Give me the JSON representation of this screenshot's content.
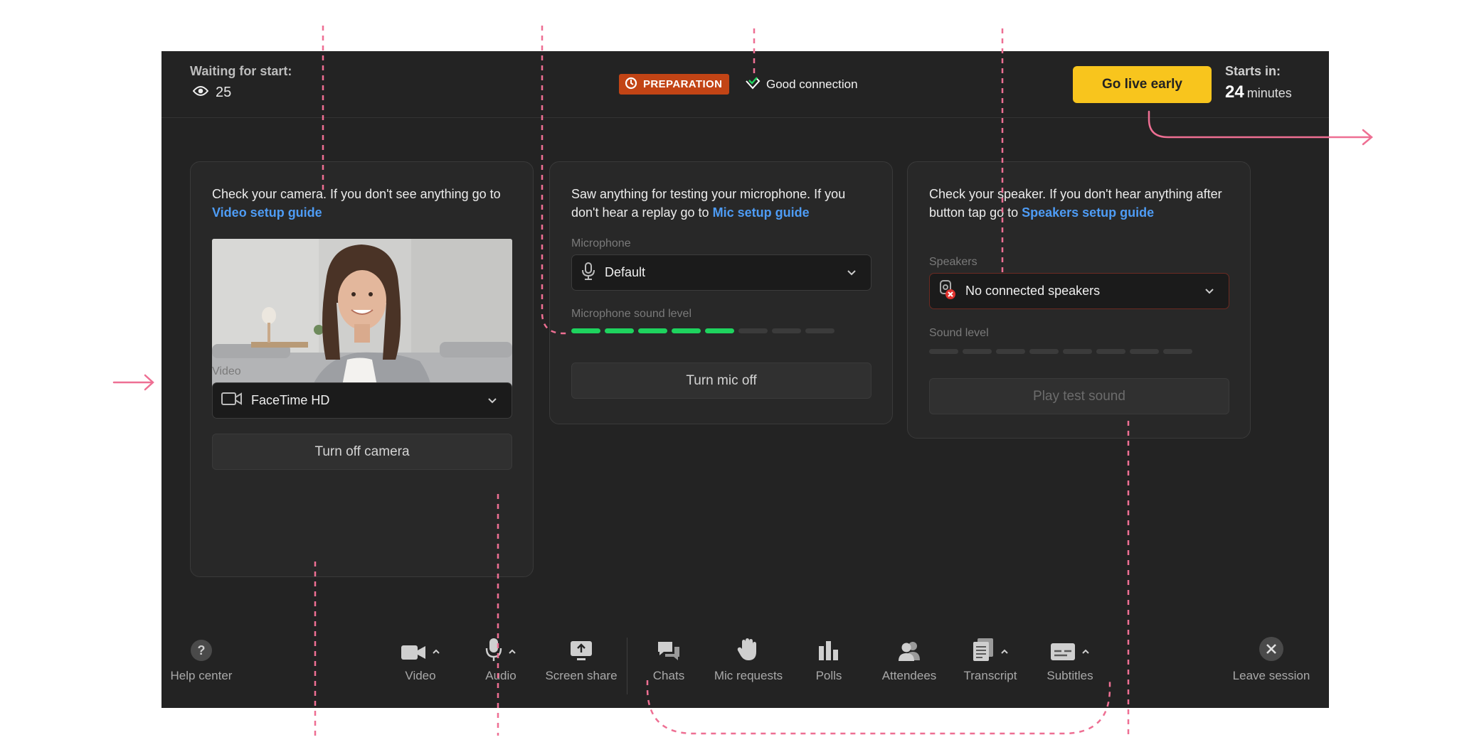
{
  "header": {
    "waiting_label": "Waiting for start:",
    "viewer_count": "25",
    "status_badge": "PREPARATION",
    "connection_status": "Good connection",
    "go_live_label": "Go live early",
    "starts_in_label": "Starts in:",
    "starts_in_value": "24",
    "starts_in_unit": "minutes"
  },
  "camera_card": {
    "text": "Check your camera. If you don't see anything go to ",
    "link": "Video setup guide",
    "field_label": "Video",
    "device": "FaceTime HD",
    "button": "Turn off camera"
  },
  "mic_card": {
    "text": "Saw anything for testing your microphone. If you don't hear a replay go to ",
    "link": "Mic setup guide",
    "field_label": "Microphone",
    "device": "Default",
    "level_label": "Microphone sound level",
    "level_active_segments": 5,
    "level_total_segments": 8,
    "button": "Turn mic off"
  },
  "speaker_card": {
    "text": "Check your speaker. If you don't hear  anything after button tap go to ",
    "link": "Speakers setup guide",
    "field_label": "Speakers",
    "device": "No connected speakers",
    "level_label": "Sound level",
    "level_active_segments": 0,
    "level_total_segments": 8,
    "button": "Play test sound"
  },
  "toolbar": {
    "help": "Help center",
    "video": "Video",
    "audio": "Audio",
    "screen_share": "Screen share",
    "chats": "Chats",
    "mic_requests": "Mic requests",
    "polls": "Polls",
    "attendees": "Attendees",
    "transcript": "Transcript",
    "subtitles": "Subtitles",
    "leave": "Leave session"
  },
  "colors": {
    "app_background": "#232323",
    "card_background": "#282828",
    "accent_yellow": "#f8c51d",
    "badge_orange": "#c24415",
    "link_blue": "#4e9cf5",
    "level_green": "#1ed35e",
    "annotation_pink": "#ee6f93",
    "error_red": "#e0332f"
  },
  "icons": {
    "viewers": "eye-icon",
    "badge": "refresh-icon",
    "connection": "signal-check-icon",
    "camera_select": "video-camera-icon",
    "mic_select": "microphone-icon",
    "speaker_select": "speaker-error-icon",
    "dropdown": "chevron-down-icon"
  }
}
